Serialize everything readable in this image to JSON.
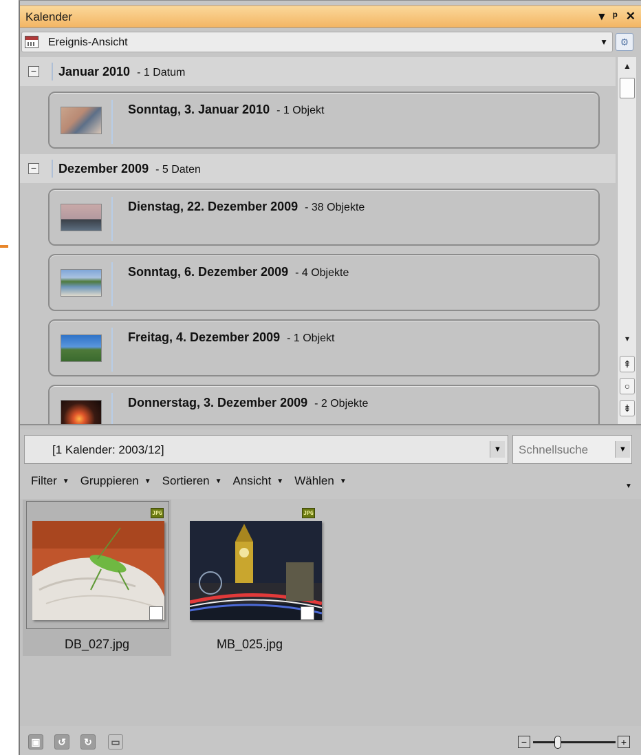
{
  "window": {
    "title": "Kalender",
    "title_icons": [
      "dropdown-arrow-icon",
      "pin-icon",
      "close-icon"
    ]
  },
  "view_selector": {
    "value": "Ereignis-Ansicht",
    "icon": "calendar-icon"
  },
  "groups": [
    {
      "month": "Januar 2010",
      "count": "- 1 Datum",
      "days": [
        {
          "label": "Sonntag, 3. Januar 2010",
          "count": "- 1 Objekt"
        }
      ]
    },
    {
      "month": "Dezember 2009",
      "count": "- 5 Daten",
      "days": [
        {
          "label": "Dienstag, 22. Dezember 2009",
          "count": "- 38 Objekte"
        },
        {
          "label": "Sonntag, 6. Dezember 2009",
          "count": "- 4 Objekte"
        },
        {
          "label": "Freitag, 4. Dezember 2009",
          "count": "- 1 Objekt"
        },
        {
          "label": "Donnerstag, 3. Dezember 2009",
          "count": "- 2 Objekte"
        }
      ]
    }
  ],
  "filter": {
    "value": "[1 Kalender: 2003/12]"
  },
  "quick_search": {
    "placeholder": "Schnellsuche"
  },
  "menu": {
    "filter": "Filter",
    "group": "Gruppieren",
    "sort": "Sortieren",
    "view": "Ansicht",
    "select": "Wählen"
  },
  "files": [
    {
      "name": "DB_027.jpg",
      "type": "JPG",
      "selected": true
    },
    {
      "name": "MB_025.jpg",
      "type": "JPG",
      "selected": false
    }
  ],
  "zoom": {
    "level_fraction": 0.3
  },
  "colors": {
    "title_bar": "#f6bf73",
    "accent_marker": "#e8862a"
  }
}
